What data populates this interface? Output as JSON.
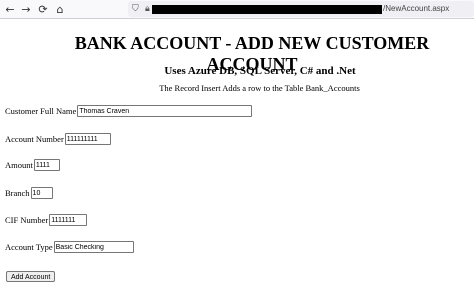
{
  "browser": {
    "url_suffix": "/NewAccount.aspx",
    "back_icon": "back-arrow-icon",
    "forward_icon": "forward-arrow-icon",
    "reload_icon": "reload-icon",
    "home_icon": "home-icon"
  },
  "page": {
    "title": "BANK ACCOUNT - ADD NEW CUSTOMER ACCOUNT",
    "subtitle": "Uses Azure DB, SQL Server, C# and .Net",
    "note": "The Record Insert Adds a row to the Table Bank_Accounts"
  },
  "form": {
    "full_name": {
      "label": "Customer Full Name",
      "value": "Thomas Craven"
    },
    "account_number": {
      "label": "Account Number",
      "value": "111111111"
    },
    "amount": {
      "label": "Amount",
      "value": "1111"
    },
    "branch": {
      "label": "Branch",
      "value": "10"
    },
    "cif_number": {
      "label": "CIF Number",
      "value": "1111111"
    },
    "account_type": {
      "label": "Account Type",
      "value": "Basic Checking"
    },
    "submit_label": "Add Account"
  }
}
